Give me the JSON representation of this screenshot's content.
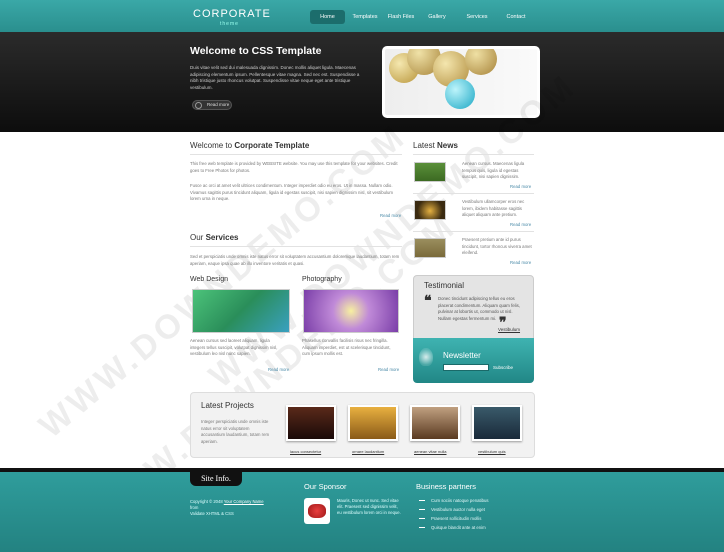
{
  "header": {
    "logo": "CORPORATE",
    "logo_sub": "theme",
    "nav": [
      "Home",
      "Templates",
      "Flash Files",
      "Gallery",
      "Services",
      "Contact"
    ]
  },
  "hero": {
    "title": "Welcome to CSS Template",
    "text": "Duis vitae velit sed dui malesuada dignissim. Donec mollis aliquet ligula. Maecenas adipiscing elementum ipsum. Pellentesque vitae magna. Sed nec est. Suspendisse a nibh tristique justo rhoncus volutpat. Suspendisse vitae neque eget ante tristique vestibulum.",
    "read_more": "Read more"
  },
  "welcome": {
    "title_prefix": "Welcome to",
    "title_bold": "Corporate Template",
    "text1": "This free web template is provided by WEBSITE website. You may use this template for your websites. Credit goes to Free Photos for photos.",
    "text2": "Fusce ac orci at amet velit ultrices condimentum. Integer imperdiet odio eu eros. Ut in massa. Nullam odio. Vivamus sagittis purus tincidunt aliquam, ligula id egestas suscipit, nisi sapien dignissim nisl, sit vestibulum lorem urna in neque.",
    "read_more": "Read more"
  },
  "services": {
    "title_prefix": "Our",
    "title_bold": "Services",
    "text": "Sed et perspiciatis unde omnis iste natus error sit voluptatem accusantium doloremque laudantium, totam rem aperiam, eaque ipsa quae ab illo inventore veritatis et quasi.",
    "web_title": "Web Design",
    "web_text": "Aenean cursus sed laoreet aliquam, ligula integers tellus suscipit, volutpat dignissim nisl, vestibulum leo nisl nunc sapien.",
    "photo_title": "Photography",
    "photo_text": "Phasellus convallis facilisis risus nec fringilla. Aliquam imperdiet, est ut scelerisque tincidunt, cum ipsum mollis est.",
    "read_more": "Read more"
  },
  "latest_news": {
    "title_prefix": "Latest",
    "title_bold": "News",
    "items": [
      {
        "text": "Aenean cursus. Maecenas ligula tempus quis, ligula id egestas suscipit, nisi sapien dignissim.",
        "read_more": "Read more"
      },
      {
        "text": "Vestibulum ullamcorper eros nec lorem, ibidem habitasse sagittis aliquet aliquam ante pretium.",
        "read_more": "Read more"
      },
      {
        "text": "Praesent pretium ante id purus tincidunt, tortor rhoncus viverra amet eleifend.",
        "read_more": "Read more"
      }
    ]
  },
  "testimonial": {
    "title": "Testimonial",
    "text": "Donec tincidunt adipiscing tellus eu eros placerat condimentum. Aliquam quam felis, pulvinar at lobortis ut, commodo ut nisl. Nullam egestas fermentum mi.",
    "author": "Vestibulum"
  },
  "newsletter": {
    "title": "Newsletter",
    "button": "Subscribe"
  },
  "projects": {
    "title": "Latest Projects",
    "text": "Integer perspiciatis unde omnis iste natus error sit voluptatem accusantium laudantium, totam rem aperiam.",
    "links": [
      "lacus consectetur",
      "ornare laudantium",
      "aenean vitae nulla",
      "vestibulum quis"
    ]
  },
  "footer": {
    "site_info": "Site Info.",
    "copyright": "Copyright © 2048",
    "company": "Your Company Name",
    "line2": "from",
    "line3": "Validate XHTML & CSS",
    "sponsor_title": "Our Sponsor",
    "sponsor_text": "Mauris, Donec ut nunc. Sed vitae elit. Praesent sed dignissim velit, eu vestibulum lorem orci in neque.",
    "business_title": "Business partners",
    "partners": [
      "Cum sociis natoque penatibus",
      "Vestibulum auctor nulla eget",
      "Praesent sollicitudin mollis",
      "Quisque blandit ante at enim"
    ]
  },
  "colors": {
    "teal": "#2f9c9b",
    "dark": "#111111",
    "link": "#4a8aa8"
  }
}
